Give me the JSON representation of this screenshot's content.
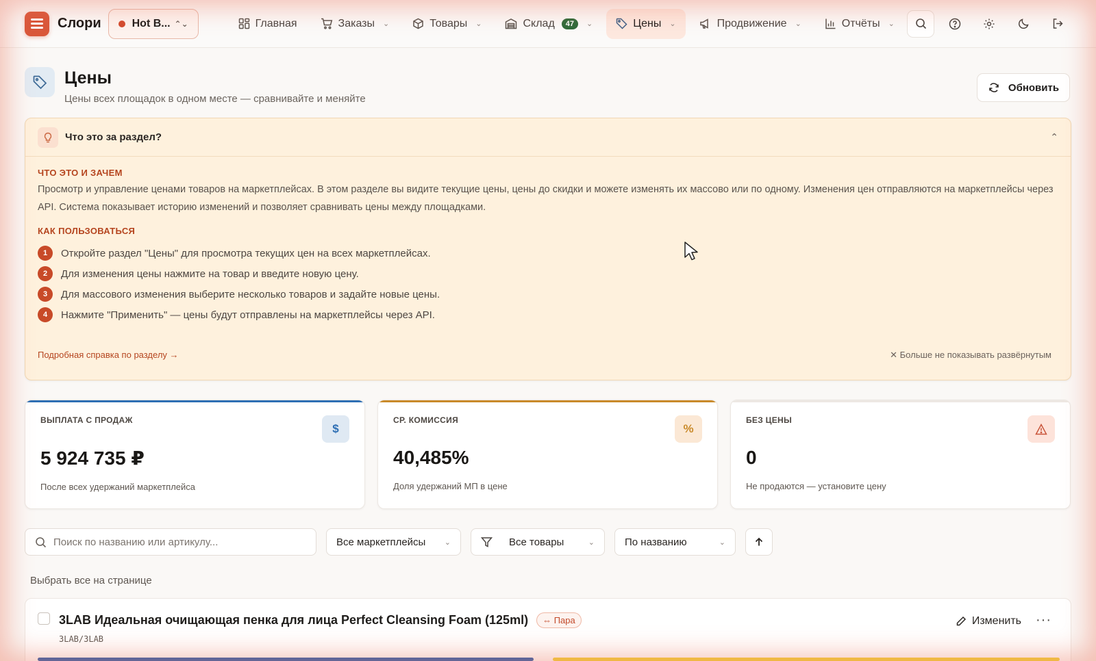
{
  "topbar": {
    "brand": "Слори",
    "store": "Hot B...",
    "nav": [
      {
        "label": "Главная",
        "icon": "grid-icon",
        "dropdown": false
      },
      {
        "label": "Заказы",
        "icon": "cart-icon",
        "dropdown": true
      },
      {
        "label": "Товары",
        "icon": "box-icon",
        "dropdown": true
      },
      {
        "label": "Склад",
        "icon": "warehouse-icon",
        "dropdown": true,
        "badge": "47"
      },
      {
        "label": "Цены",
        "icon": "tag-icon",
        "dropdown": true,
        "active": true
      },
      {
        "label": "Продвижение",
        "icon": "megaphone-icon",
        "dropdown": true
      },
      {
        "label": "Отчёты",
        "icon": "chart-icon",
        "dropdown": true
      }
    ]
  },
  "header": {
    "title": "Цены",
    "subtitle": "Цены всех площадок в одном месте — сравнивайте и меняйте",
    "refresh_label": "Обновить"
  },
  "help": {
    "question": "Что это за раздел?",
    "what_title": "ЧТО ЭТО И ЗАЧЕМ",
    "what_text": "Просмотр и управление ценами товаров на маркетплейсах. В этом разделе вы видите текущие цены, цены до скидки и можете изменять их массово или по одному. Изменения цен отправляются на маркетплейсы через API. Система показывает историю изменений и позволяет сравнивать цены между площадками.",
    "how_title": "КАК ПОЛЬЗОВАТЬСЯ",
    "steps": [
      {
        "n": "1",
        "text": "Откройте раздел \"Цены\" для просмотра текущих цен на всех маркетплейсах."
      },
      {
        "n": "2",
        "text": "Для изменения цены нажмите на товар и введите новую цену."
      },
      {
        "n": "3",
        "text": "Для массового изменения выберите несколько товаров и задайте новые цены."
      },
      {
        "n": "4",
        "text": "Нажмите \"Применить\" — цены будут отправлены на маркетплейсы через API."
      }
    ],
    "link": "Подробная справка по разделу →",
    "hide": "Больше не показывать развёрнутым"
  },
  "cards": [
    {
      "label": "ВЫПЛАТА С ПРОДАЖ",
      "value": "5 924 735 ₽",
      "note": "После всех удержаний маркетплейса",
      "icon": "dollar-icon",
      "accent": "#2e6fb4"
    },
    {
      "label": "СР. КОМИССИЯ",
      "value": "40,485%",
      "note": "Доля удержаний МП в цене",
      "icon": "percent-icon",
      "accent": "#c98a2a"
    },
    {
      "label": "БЕЗ ЦЕНЫ",
      "value": "0",
      "note": "Не продаются — установите цену",
      "icon": "warning-icon",
      "accent": "#e9e4df"
    }
  ],
  "filters": {
    "search_placeholder": "Поиск по названию или артикулу...",
    "marketplace": "Все маркетплейсы",
    "products": "Все товары",
    "sort": "По названию"
  },
  "select_all": "Выбрать все на странице",
  "product": {
    "name": "3LAB Идеальная очищающая пенка для лица Perfect Cleansing Foam (125ml)",
    "pair": "Пара",
    "sku": "3LAB/3LAB",
    "edit": "Изменить"
  }
}
